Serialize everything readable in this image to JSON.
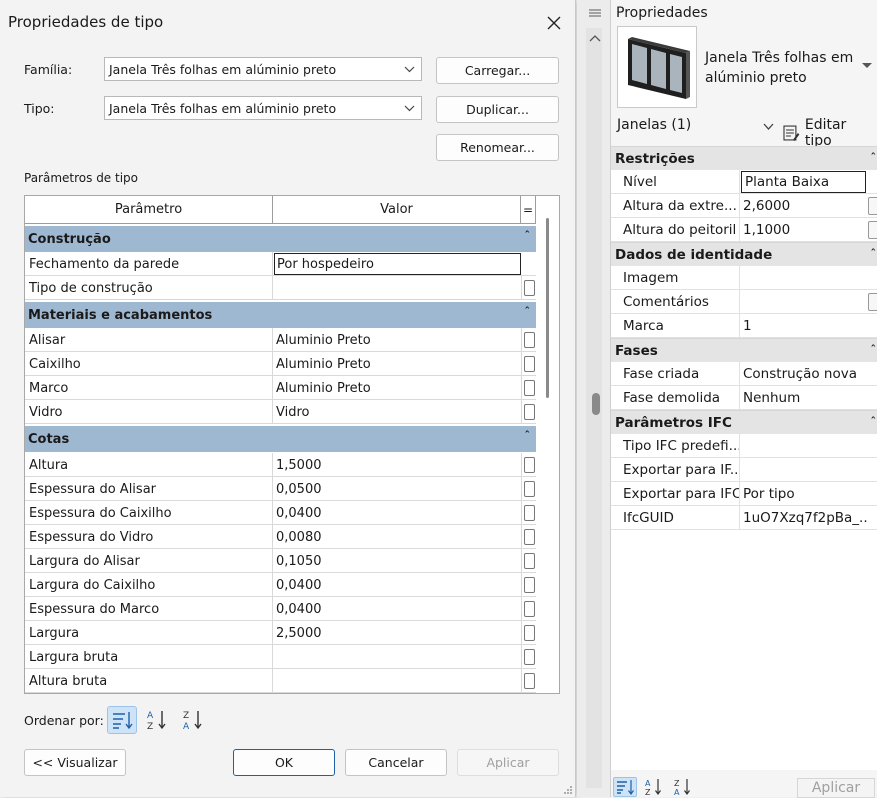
{
  "dialog": {
    "title": "Propriedades de tipo",
    "family_label": "Família:",
    "family_value": "Janela Três folhas em alúminio preto",
    "type_label": "Tipo:",
    "type_value": "Janela Três folhas em alúminio preto",
    "load_button": "Carregar...",
    "duplicate_button": "Duplicar...",
    "rename_button": "Renomear...",
    "params_label": "Parâmetros de tipo",
    "grid_headers": {
      "param": "Parâmetro",
      "value": "Valor",
      "eq": "="
    },
    "groups": [
      {
        "name": "Construção",
        "rows": [
          {
            "param": "Fechamento da parede",
            "value": "Por hospedeiro"
          },
          {
            "param": "Tipo de construção",
            "value": ""
          }
        ]
      },
      {
        "name": "Materiais e acabamentos",
        "rows": [
          {
            "param": "Alisar",
            "value": "Aluminio Preto"
          },
          {
            "param": "Caixilho",
            "value": "Aluminio Preto"
          },
          {
            "param": "Marco",
            "value": "Aluminio Preto"
          },
          {
            "param": "Vidro",
            "value": "Vidro"
          }
        ]
      },
      {
        "name": "Cotas",
        "rows": [
          {
            "param": "Altura",
            "value": "1,5000"
          },
          {
            "param": "Espessura do Alisar",
            "value": "0,0500"
          },
          {
            "param": "Espessura do Caixilho",
            "value": "0,0400"
          },
          {
            "param": "Espessura do Vidro",
            "value": "0,0080"
          },
          {
            "param": "Largura do Alisar",
            "value": "0,1050"
          },
          {
            "param": "Largura do Caixilho",
            "value": "0,0400"
          },
          {
            "param": "Espessura do Marco",
            "value": "0,0400"
          },
          {
            "param": "Largura",
            "value": "2,5000"
          },
          {
            "param": "Largura bruta",
            "value": ""
          },
          {
            "param": "Altura bruta",
            "value": ""
          }
        ]
      }
    ],
    "sort_label": "Ordenar por:",
    "preview_button": "<< Visualizar",
    "ok_button": "OK",
    "cancel_button": "Cancelar",
    "apply_button": "Aplicar"
  },
  "panel": {
    "title": "Propriedades",
    "type_name": "Janela Três folhas em alúminio preto",
    "selection": "Janelas (1)",
    "edit_type": "Editar tipo",
    "groups": [
      {
        "name": "Restrições",
        "rows": [
          {
            "key": "Nível",
            "value": "Planta Baixa"
          },
          {
            "key": "Altura da extre...",
            "value": "2,6000"
          },
          {
            "key": "Altura do peitoril",
            "value": "1,1000"
          }
        ]
      },
      {
        "name": "Dados de identidade",
        "rows": [
          {
            "key": "Imagem",
            "value": ""
          },
          {
            "key": "Comentários",
            "value": ""
          },
          {
            "key": "Marca",
            "value": "1"
          }
        ]
      },
      {
        "name": "Fases",
        "rows": [
          {
            "key": "Fase criada",
            "value": "Construção nova"
          },
          {
            "key": "Fase demolida",
            "value": "Nenhum"
          }
        ]
      },
      {
        "name": "Parâmetros IFC",
        "rows": [
          {
            "key": "Tipo IFC predefi...",
            "value": ""
          },
          {
            "key": "Exportar para IF...",
            "value": ""
          },
          {
            "key": "Exportar para IFC",
            "value": "Por tipo"
          },
          {
            "key": "IfcGUID",
            "value": "1uO7Xzq7f2pBa_..."
          }
        ]
      }
    ],
    "apply_button": "Aplicar"
  }
}
